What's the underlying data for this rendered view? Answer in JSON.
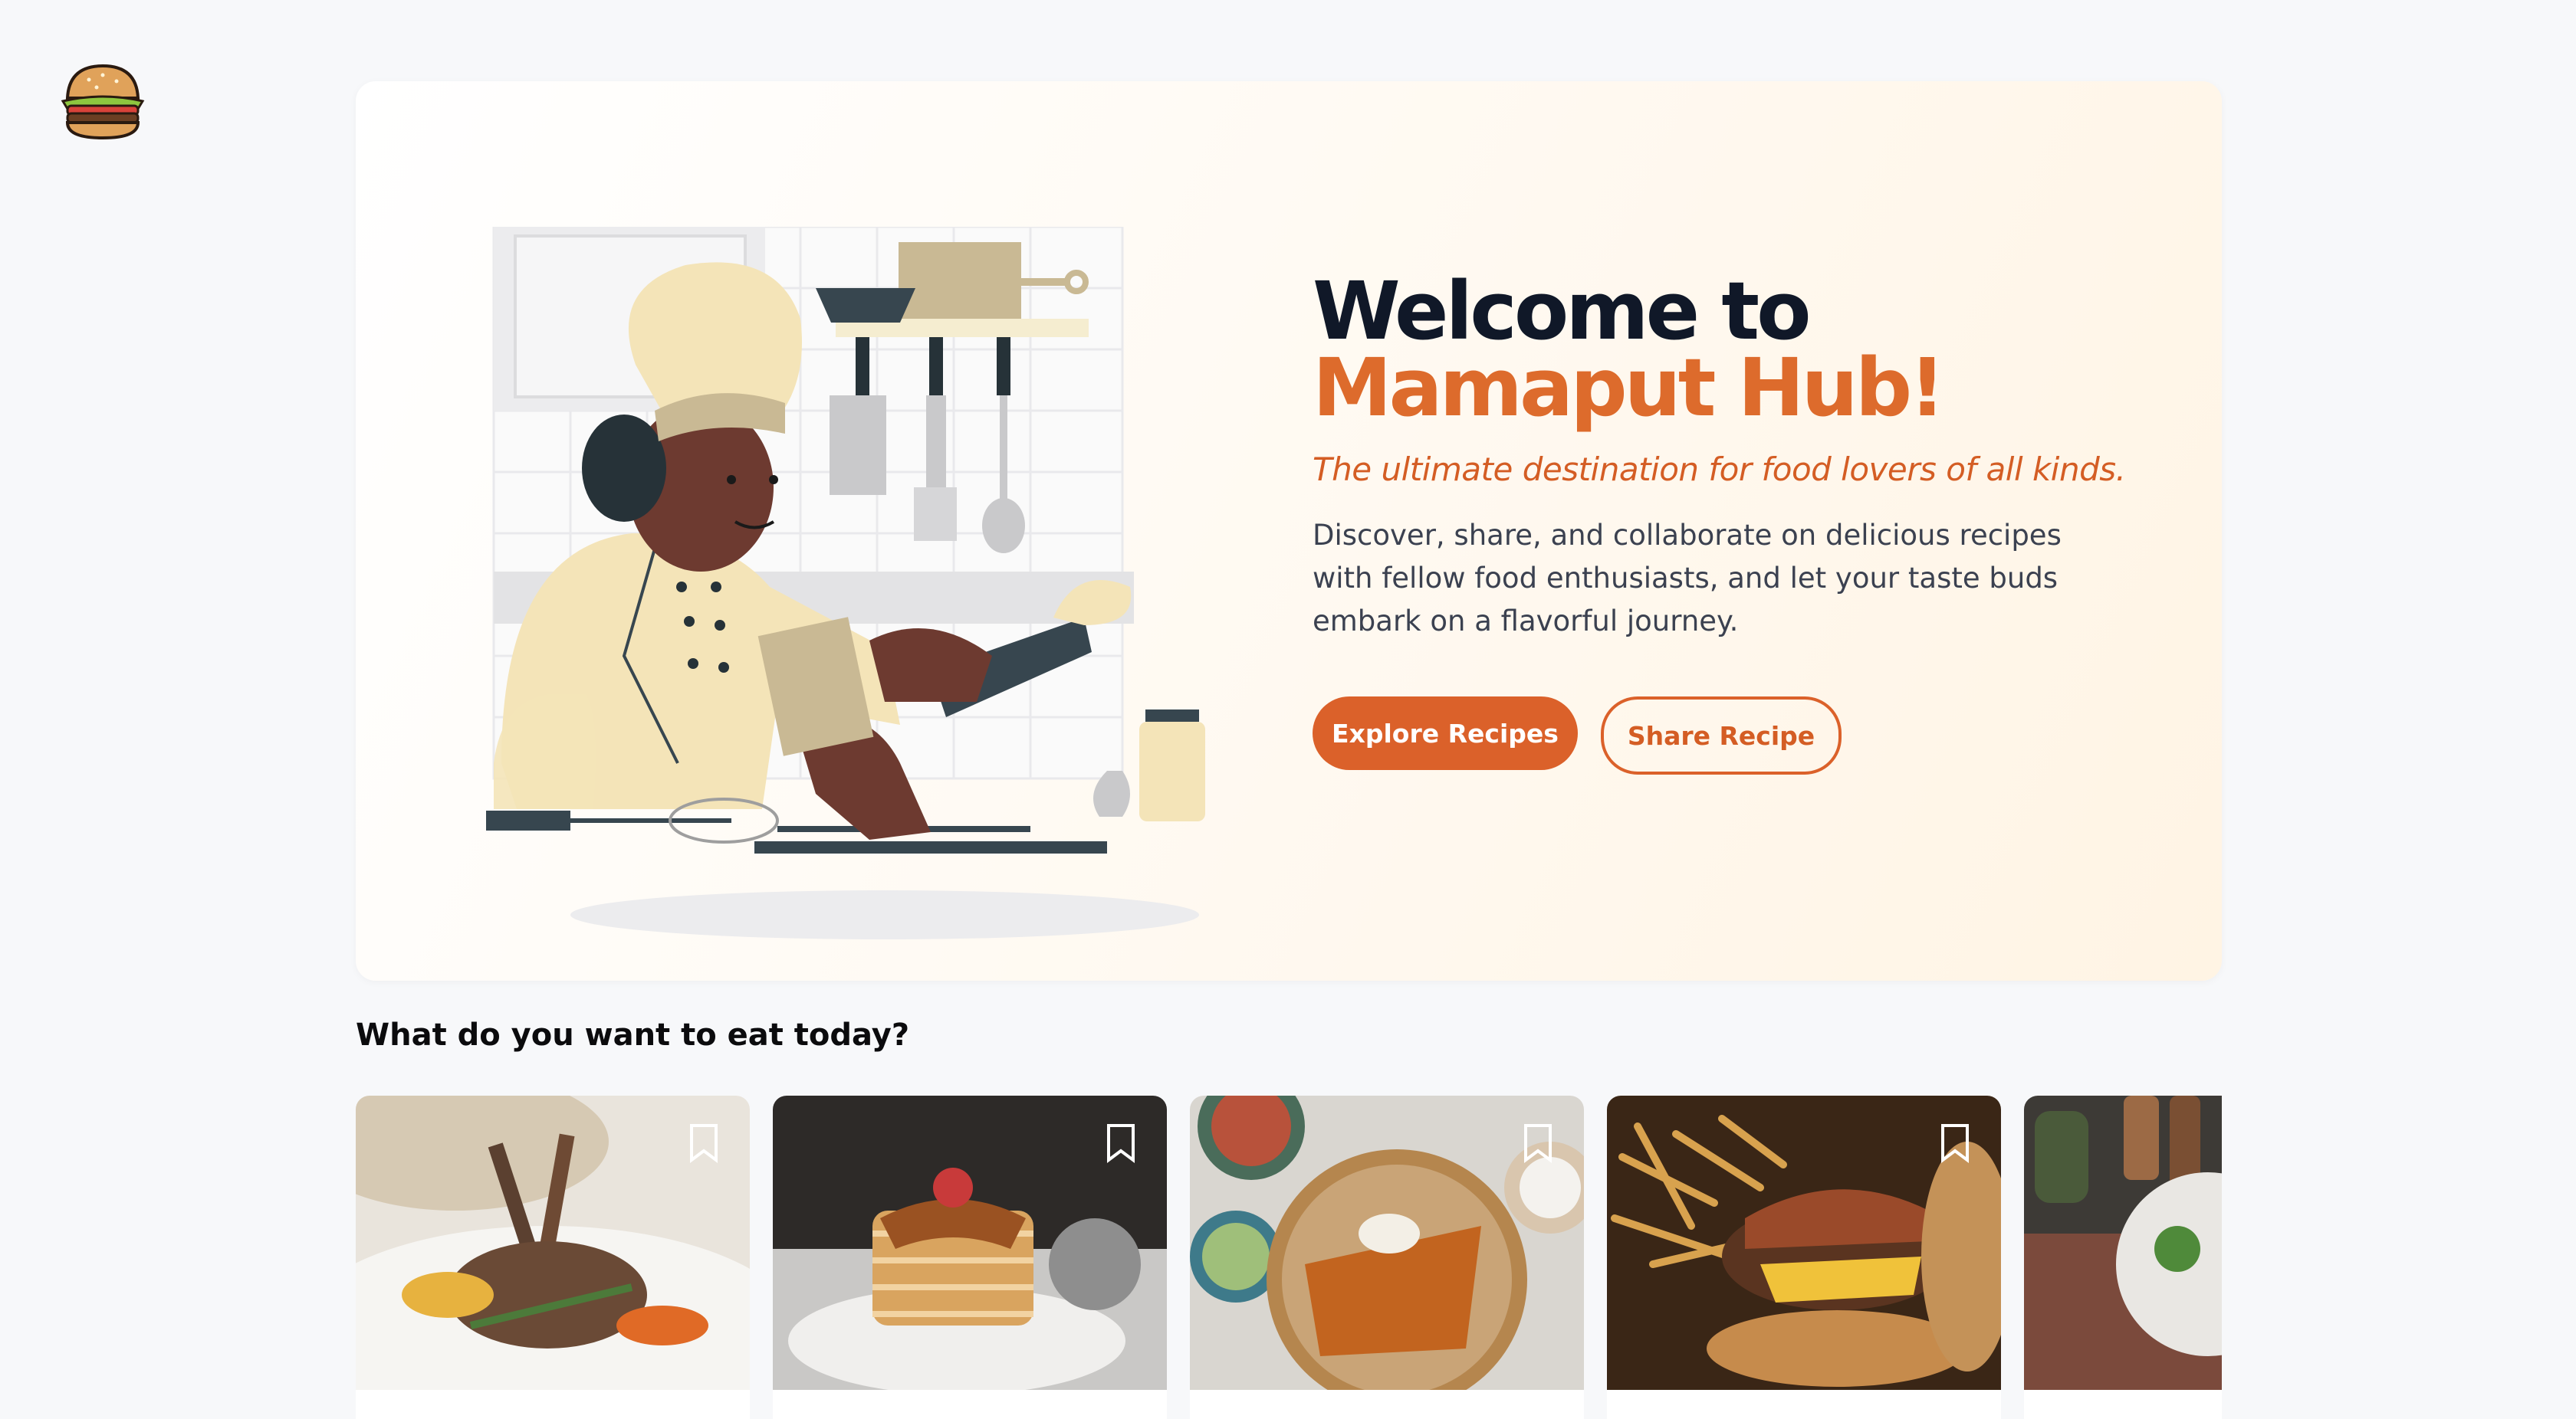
{
  "brand": {
    "logo_icon": "burger-icon"
  },
  "hero": {
    "title_prefix": "Welcome to",
    "title_accent": "Mamaput Hub!",
    "tagline": "The ultimate destination for food lovers of all kinds.",
    "description": "Discover, share, and collaborate on delicious recipes with fellow food enthusiasts, and let your taste buds embark on a flavorful journey.",
    "primary_button": "Explore Recipes",
    "secondary_button": "Share Recipe",
    "illustration_icon": "chef-cooking-illustration"
  },
  "section": {
    "title": "What do you want to eat today?"
  },
  "cards": [
    {
      "image": "lamb-chops-photo",
      "bookmark_icon": "bookmark-icon"
    },
    {
      "image": "pancakes-photo",
      "bookmark_icon": "bookmark-icon"
    },
    {
      "image": "salad-fries-photo",
      "bookmark_icon": "bookmark-icon"
    },
    {
      "image": "burger-fries-photo",
      "bookmark_icon": "bookmark-icon"
    },
    {
      "image": "spices-plate-photo",
      "bookmark_icon": "bookmark-icon"
    }
  ],
  "colors": {
    "accent": "#db612a",
    "title": "#101828",
    "background": "#f7f8fa"
  }
}
